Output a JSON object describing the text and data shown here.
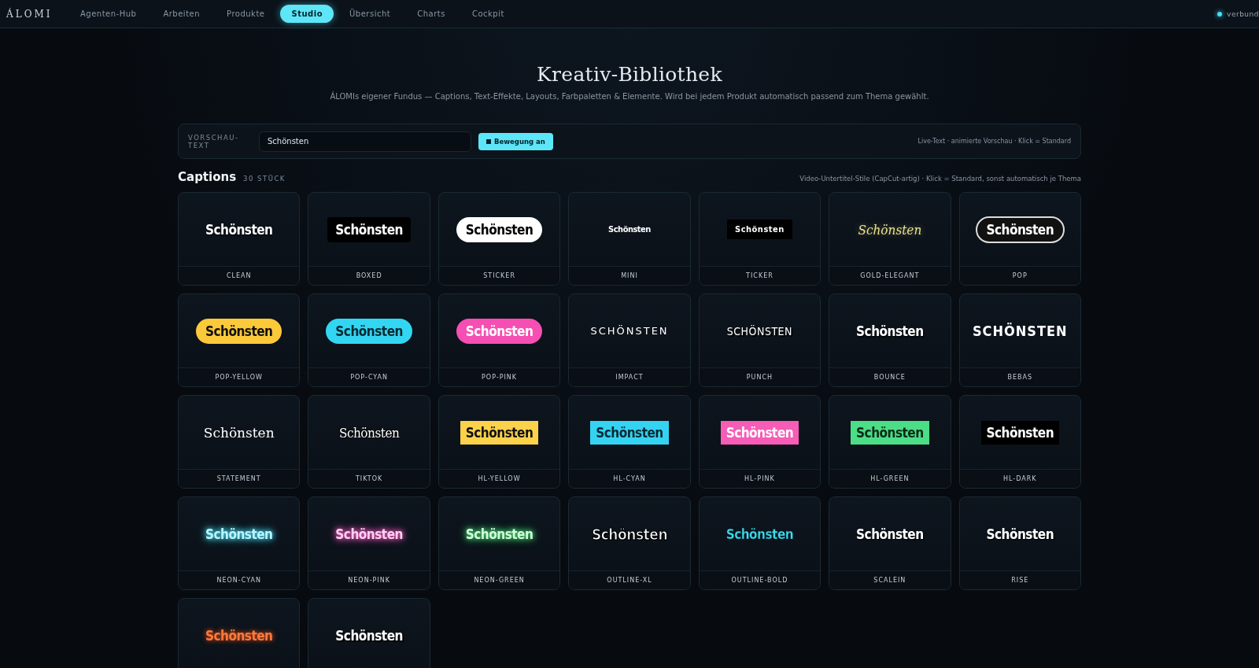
{
  "nav": {
    "logo": "ÁLOMI",
    "tabs": [
      {
        "label": "Agenten-Hub",
        "selected": false
      },
      {
        "label": "Arbeiten",
        "selected": false
      },
      {
        "label": "Produkte",
        "selected": false
      },
      {
        "label": "Studio",
        "selected": true
      },
      {
        "label": "Übersicht",
        "selected": false
      },
      {
        "label": "Charts",
        "selected": false
      },
      {
        "label": "Cockpit",
        "selected": false
      }
    ],
    "status": {
      "label": "verbund",
      "online": true
    }
  },
  "header": {
    "title": "Kreativ-Bibliothek",
    "subtitle": "ÁLOMIs eigener Fundus — Captions, Text-Effekte, Layouts, Farbpaletten & Elemente. Wird bei jedem Produkt automatisch passend zum Thema gewählt."
  },
  "toolbar": {
    "label": "VORSCHAU-TEXT",
    "value": "Schönsten",
    "toggle": {
      "label": "Bewegung an",
      "on": true
    },
    "hint": "Live-Text · animierte Vorschau · Klick = Standard"
  },
  "section": {
    "title": "Captions",
    "count": "30 STÜCK",
    "hint": "Video-Untertitel-Stile (CapCut-artig) · Klick = Standard, sonst automatisch je Thema"
  },
  "cards": [
    {
      "kind": "clean",
      "preview": "Schönsten",
      "label": "CLEAN"
    },
    {
      "kind": "boxed",
      "preview": "Schönsten",
      "label": "BOXED"
    },
    {
      "kind": "sticker",
      "preview": "Schönsten",
      "label": "STICKER"
    },
    {
      "kind": "mini",
      "preview": "Schönsten",
      "label": "MINI"
    },
    {
      "kind": "ticker",
      "preview": "Schönsten",
      "label": "TICKER"
    },
    {
      "kind": "gold",
      "preview": "Schönsten",
      "label": "GOLD-ELEGANT"
    },
    {
      "kind": "pop",
      "preview": "Schönsten",
      "label": "POP"
    },
    {
      "kind": "popyellow",
      "preview": "Schönsten",
      "label": "POP-YELLOW"
    },
    {
      "kind": "popcyan",
      "preview": "Schönsten",
      "label": "POP-CYAN"
    },
    {
      "kind": "poppink",
      "preview": "Schönsten",
      "label": "POP-PINK"
    },
    {
      "kind": "impact",
      "preview": "SCHÖNSTEN",
      "label": "IMPACT"
    },
    {
      "kind": "punch",
      "preview": "SCHÖNSTEN",
      "label": "PUNCH"
    },
    {
      "kind": "bounce",
      "preview": "Schönsten",
      "label": "BOUNCE"
    },
    {
      "kind": "bebas",
      "preview": "SCHÖNSTEN",
      "label": "BEBAS"
    },
    {
      "kind": "statement",
      "preview": "Schönsten",
      "label": "STATEMENT"
    },
    {
      "kind": "tiktok",
      "preview": "Schönsten",
      "label": "TIKTOK"
    },
    {
      "kind": "hlyellow",
      "preview": "Schönsten",
      "label": "HL-YELLOW"
    },
    {
      "kind": "hlcyan",
      "preview": "Schönsten",
      "label": "HL-CYAN"
    },
    {
      "kind": "hlpink",
      "preview": "Schönsten",
      "label": "HL-PINK"
    },
    {
      "kind": "hlgreen",
      "preview": "Schönsten",
      "label": "HL-GREEN"
    },
    {
      "kind": "hldark",
      "preview": "Schönsten",
      "label": "HL-DARK"
    },
    {
      "kind": "neoncyan",
      "preview": "Schönsten",
      "label": "NEON-CYAN"
    },
    {
      "kind": "neonpink",
      "preview": "Schönsten",
      "label": "NEON-PINK"
    },
    {
      "kind": "neongreen",
      "preview": "Schönsten",
      "label": "NEON-GREEN"
    },
    {
      "kind": "outlinexl",
      "preview": "Schönsten",
      "label": "OUTLINE-XL"
    },
    {
      "kind": "outlinebold",
      "preview": "Schönsten",
      "label": "OUTLINE-BOLD"
    },
    {
      "kind": "scalein",
      "preview": "Schönsten",
      "label": "SCALEIN"
    },
    {
      "kind": "rise",
      "preview": "Schönsten",
      "label": "RISE"
    },
    {
      "kind": "fire",
      "preview": "Schönsten"
    },
    {
      "kind": "shadow",
      "preview": "Schönsten"
    }
  ]
}
